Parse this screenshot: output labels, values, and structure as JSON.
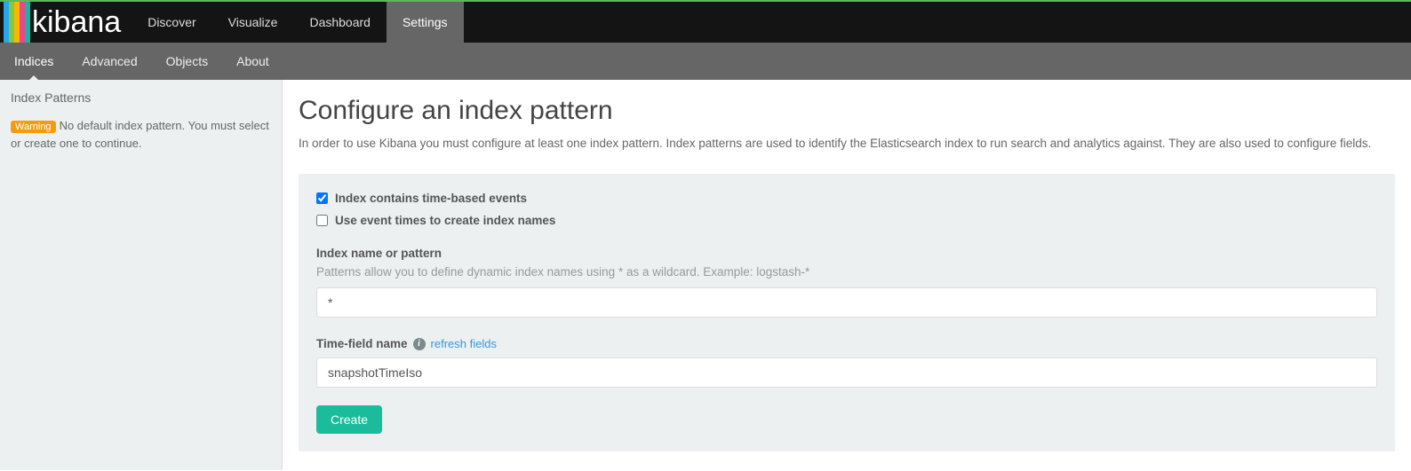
{
  "brand": "kibana",
  "topnav": {
    "items": [
      {
        "label": "Discover"
      },
      {
        "label": "Visualize"
      },
      {
        "label": "Dashboard"
      },
      {
        "label": "Settings"
      }
    ],
    "active_index": 3
  },
  "subnav": {
    "items": [
      {
        "label": "Indices"
      },
      {
        "label": "Advanced"
      },
      {
        "label": "Objects"
      },
      {
        "label": "About"
      }
    ],
    "active_index": 0
  },
  "sidebar": {
    "title": "Index Patterns",
    "warning_badge": "Warning",
    "warning_text": "No default index pattern. You must select or create one to continue."
  },
  "main": {
    "title": "Configure an index pattern",
    "description": "In order to use Kibana you must configure at least one index pattern. Index patterns are used to identify the Elasticsearch index to run search and analytics against. They are also used to configure fields."
  },
  "form": {
    "time_based_label": "Index contains time-based events",
    "time_based_checked": true,
    "event_times_label": "Use event times to create index names",
    "event_times_checked": false,
    "index_name_label": "Index name or pattern",
    "index_name_hint": "Patterns allow you to define dynamic index names using * as a wildcard. Example: logstash-*",
    "index_name_value": "*",
    "time_field_label": "Time-field name",
    "refresh_link": "refresh fields",
    "time_field_value": "snapshotTimeIso",
    "create_button": "Create"
  }
}
